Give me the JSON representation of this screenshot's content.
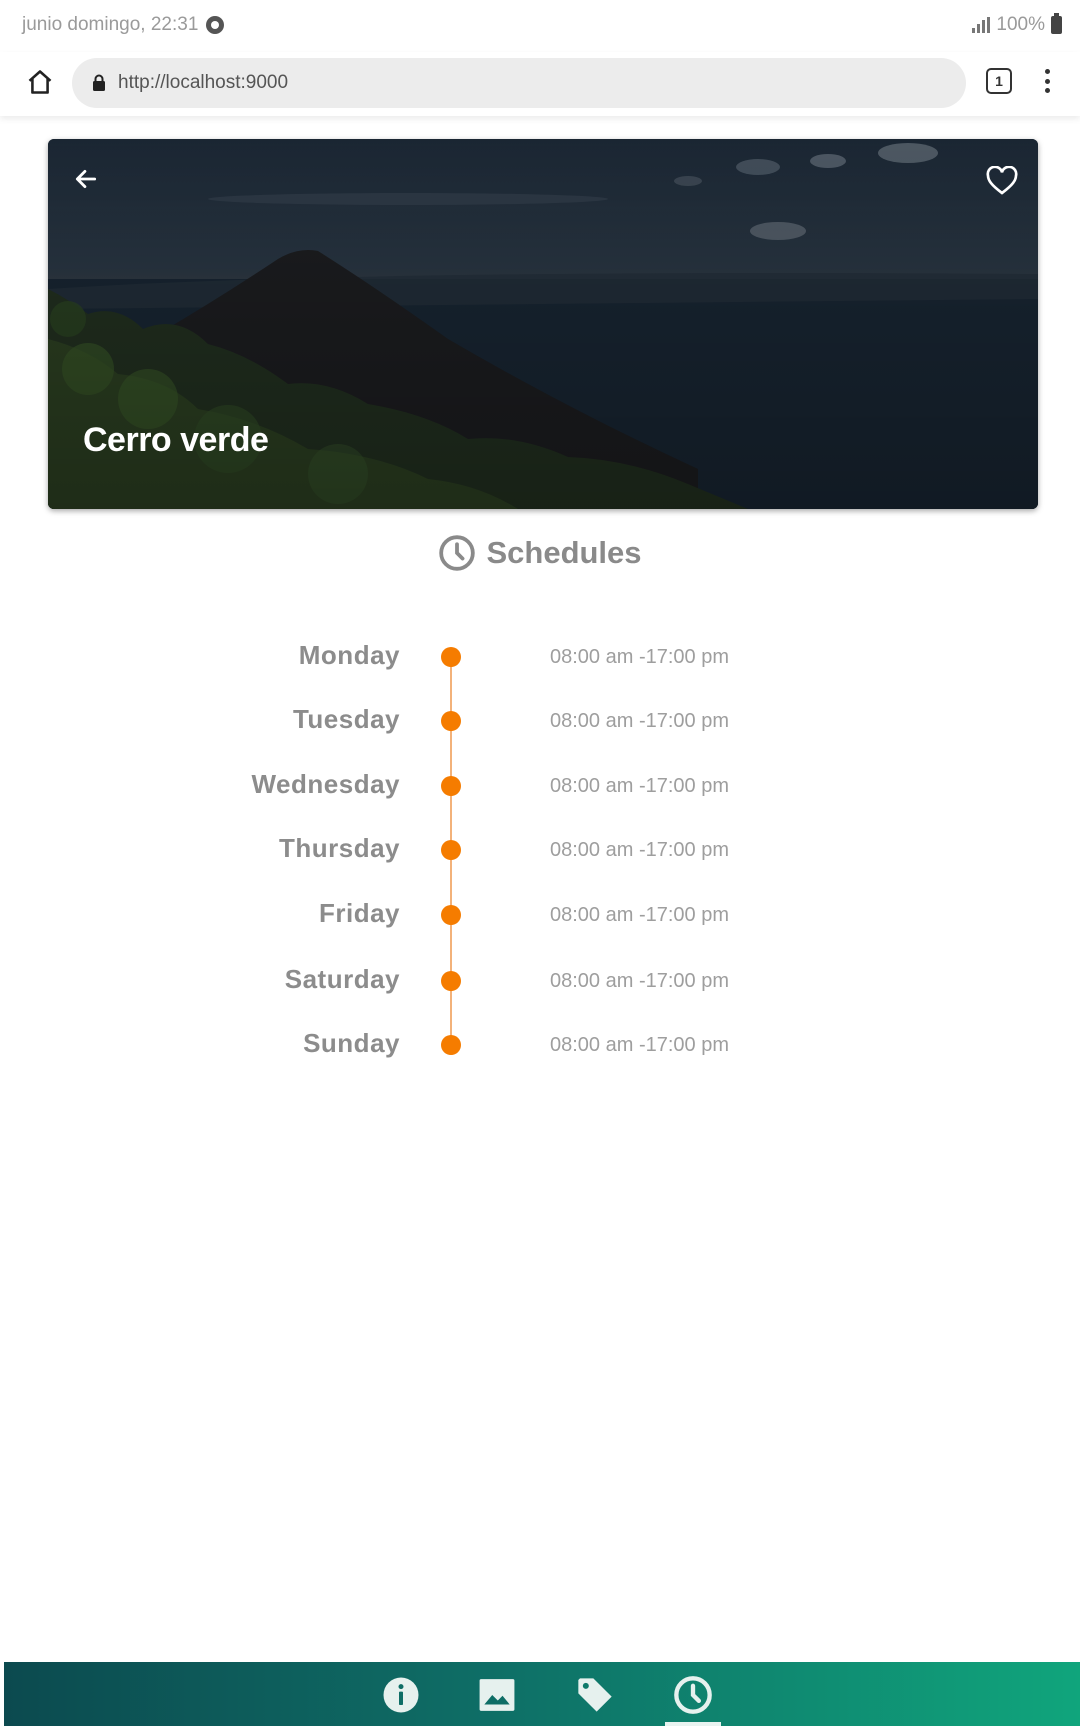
{
  "status_bar": {
    "left_text": "junio domingo, 22:31",
    "battery_text": "100%"
  },
  "browser": {
    "url": "http://localhost:9000",
    "tab_count": "1"
  },
  "place": {
    "title": "Cerro verde"
  },
  "schedules": {
    "heading": "Schedules",
    "days": [
      {
        "day": "Monday",
        "hours": "08:00 am -17:00 pm"
      },
      {
        "day": "Tuesday",
        "hours": "08:00 am -17:00 pm"
      },
      {
        "day": "Wednesday",
        "hours": "08:00 am -17:00 pm"
      },
      {
        "day": "Thursday",
        "hours": "08:00 am -17:00 pm"
      },
      {
        "day": "Friday",
        "hours": "08:00 am -17:00 pm"
      },
      {
        "day": "Saturday",
        "hours": "08:00 am -17:00 pm"
      },
      {
        "day": "Sunday",
        "hours": "08:00 am -17:00 pm"
      }
    ]
  },
  "bottom_nav": {
    "items": [
      {
        "icon": "info-icon",
        "active": false
      },
      {
        "icon": "image-icon",
        "active": false
      },
      {
        "icon": "tag-icon",
        "active": false
      },
      {
        "icon": "clock-icon",
        "active": true
      }
    ]
  },
  "colors": {
    "accent": "#f57c00",
    "nav_gradient_start": "#0c4a4f",
    "nav_gradient_end": "#10a57c"
  }
}
